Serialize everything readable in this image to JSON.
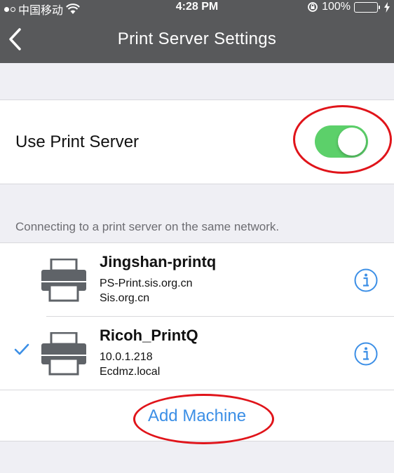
{
  "status_bar": {
    "carrier": "中国移动",
    "time": "4:28 PM",
    "battery_percent": "100%",
    "battery_level": 1.0
  },
  "nav": {
    "title": "Print Server Settings",
    "back_icon": "chevron-left-icon"
  },
  "settings": {
    "use_print_server_label": "Use Print Server",
    "use_print_server_on": true,
    "toggle_color": "#5cd06a"
  },
  "section_caption": "Connecting to a print server on the same network.",
  "machines": [
    {
      "name": "Jingshan-printq",
      "line1": "PS-Print.sis.org.cn",
      "line2": "Sis.org.cn",
      "selected": false
    },
    {
      "name": "Ricoh_PrintQ",
      "line1": "10.0.1.218",
      "line2": "Ecdmz.local",
      "selected": true
    }
  ],
  "add_machine_label": "Add Machine",
  "colors": {
    "header_bg": "#58595b",
    "accent": "#3c8fe6",
    "annotation": "#e0141a"
  }
}
